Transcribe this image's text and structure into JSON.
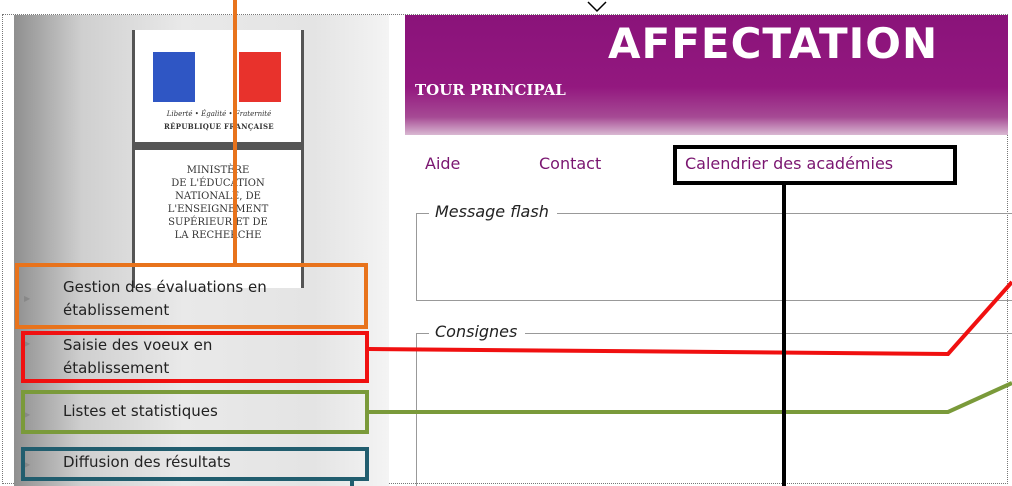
{
  "sidebar": {
    "logo": {
      "motto": "Liberté • Égalité • Fraternité",
      "republic": "RÉPUBLIQUE FRANÇAISE",
      "ministry_lines": [
        "MINISTÈRE",
        "DE L'ÉDUCATION",
        "NATIONALE, DE",
        "L'ENSEIGNEMENT",
        "SUPÉRIEUR ET DE",
        "LA RECHERCHE"
      ]
    },
    "menu": [
      {
        "label_lines": [
          "Gestion des évaluations en",
          "établissement"
        ]
      },
      {
        "label_lines": [
          "Saisie des voeux en",
          "établissement"
        ]
      },
      {
        "label_lines": [
          "Listes et statistiques"
        ]
      },
      {
        "label_lines": [
          "Diffusion des résultats"
        ]
      }
    ]
  },
  "header": {
    "title": "AFFECTATION",
    "subtitle": "TOUR PRINCIPAL"
  },
  "nav": {
    "items": [
      "Aide",
      "Contact",
      "Calendrier des académies"
    ]
  },
  "panels": {
    "message_flash": "Message flash",
    "consignes": "Consignes"
  },
  "annotation_colors": {
    "orange": "#e8731c",
    "red": "#f01010",
    "green": "#7a9a3a",
    "teal": "#215d6e",
    "black": "#000000"
  }
}
